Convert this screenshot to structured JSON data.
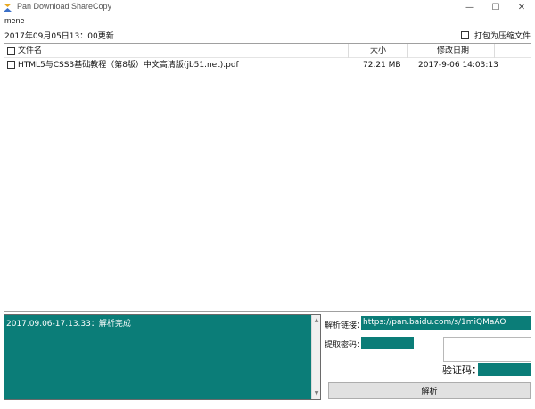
{
  "window": {
    "title": "Pan Download ShareCopy",
    "min_glyph": "—",
    "max_glyph": "☐",
    "close_glyph": "✕"
  },
  "header": {
    "user": "mene",
    "update_notice": "2017年09月05日13：00更新",
    "zip_label": "打包为压缩文件",
    "zip_checked": false
  },
  "file_list": {
    "columns": {
      "name": "文件名",
      "size": "大小",
      "date": "修改日期"
    },
    "rows": [
      {
        "name": "HTML5与CSS3基础教程（第8版）中文高清版(jb51.net).pdf",
        "size": "72.21 MB",
        "date": "2017-9-06 14:03:13",
        "checked": false
      }
    ]
  },
  "log": {
    "text": "2017.09.06-17.13.33：解析完成"
  },
  "form": {
    "link_label": "解析链接：",
    "link_value": "https://pan.baidu.com/s/1miQMaAO",
    "password_label": "提取密码：",
    "password_value": "",
    "captcha_label": "验证码：",
    "captcha_value": "",
    "parse_button": "解析"
  },
  "colors": {
    "teal": "#0b7d78"
  },
  "icons": {
    "app": "arrows-app-icon"
  }
}
